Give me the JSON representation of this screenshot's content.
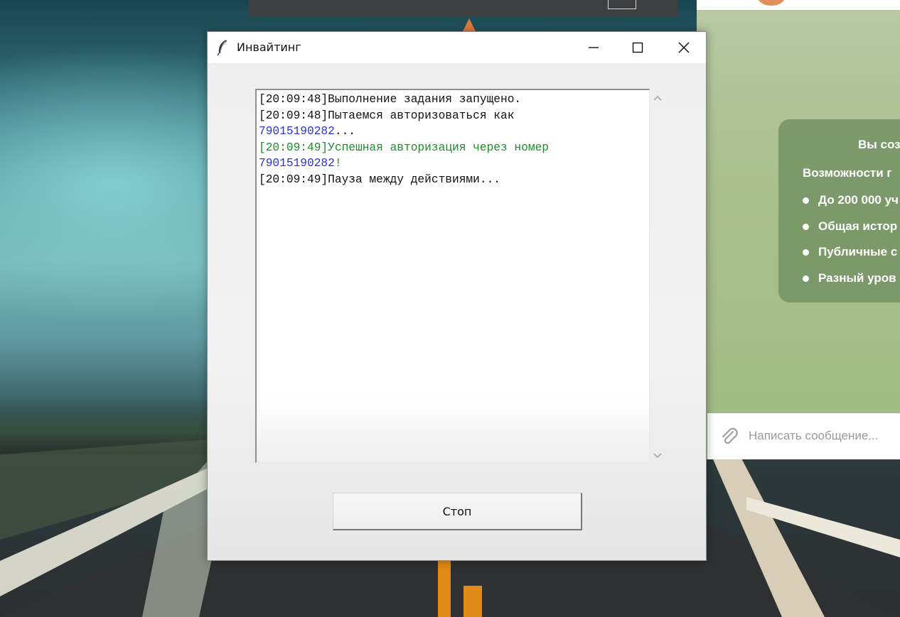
{
  "window": {
    "title": "Инвайтинг",
    "icon": "feather-icon",
    "controls": [
      "minimize-icon",
      "maximize-icon",
      "close-icon"
    ]
  },
  "log": {
    "lines": [
      [
        {
          "text": "[20:09:48]Выполнение задания запущено.",
          "color": "black"
        }
      ],
      [
        {
          "text": "[20:09:48]Пытаемся авторизоваться как",
          "color": "black"
        }
      ],
      [
        {
          "text": "79015190282",
          "color": "blue"
        },
        {
          "text": "...",
          "color": "black"
        }
      ],
      [
        {
          "text": "[20:09:49]Успешная авторизация через номер",
          "color": "green"
        }
      ],
      [
        {
          "text": "79015190282",
          "color": "blue"
        },
        {
          "text": "!",
          "color": "green"
        }
      ],
      [
        {
          "text": "[20:09:49]Пауза между действиями...",
          "color": "black"
        }
      ]
    ]
  },
  "stop_button": {
    "label": "Стоп"
  },
  "background_telegram": {
    "card_line1": "Вы соз",
    "card_line2": "Возможности г",
    "bullets": [
      "До 200 000 уч",
      "Общая истор",
      "Публичные с",
      "Разный уров"
    ],
    "input_placeholder": "Написать сообщение..."
  },
  "colors": {
    "log_blue": "#2a33d6",
    "log_green": "#1e8e2a",
    "window_bg": "#f0f0f0"
  }
}
